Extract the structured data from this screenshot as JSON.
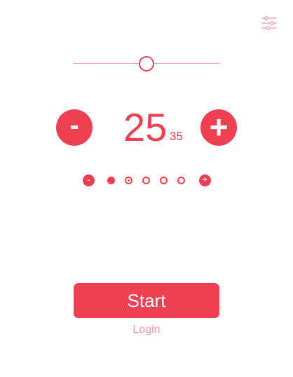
{
  "colors": {
    "accent": "#ef3f52",
    "accent_light": "#f19aa3",
    "background": "#ffffff"
  },
  "header": {
    "settings_icon": "sliders-icon"
  },
  "slider": {
    "value_fraction": 0.5
  },
  "counter": {
    "decrement_label": "-",
    "value": "25",
    "subvalue": "35",
    "increment_label": "+"
  },
  "level": {
    "decrement_label": "-",
    "increment_label": "+",
    "dots": [
      {
        "state": "filled"
      },
      {
        "state": "selected"
      },
      {
        "state": "empty"
      },
      {
        "state": "empty"
      },
      {
        "state": "empty"
      }
    ],
    "selected_index": 2,
    "total": 5
  },
  "actions": {
    "start_label": "Start",
    "login_label": "Login"
  }
}
